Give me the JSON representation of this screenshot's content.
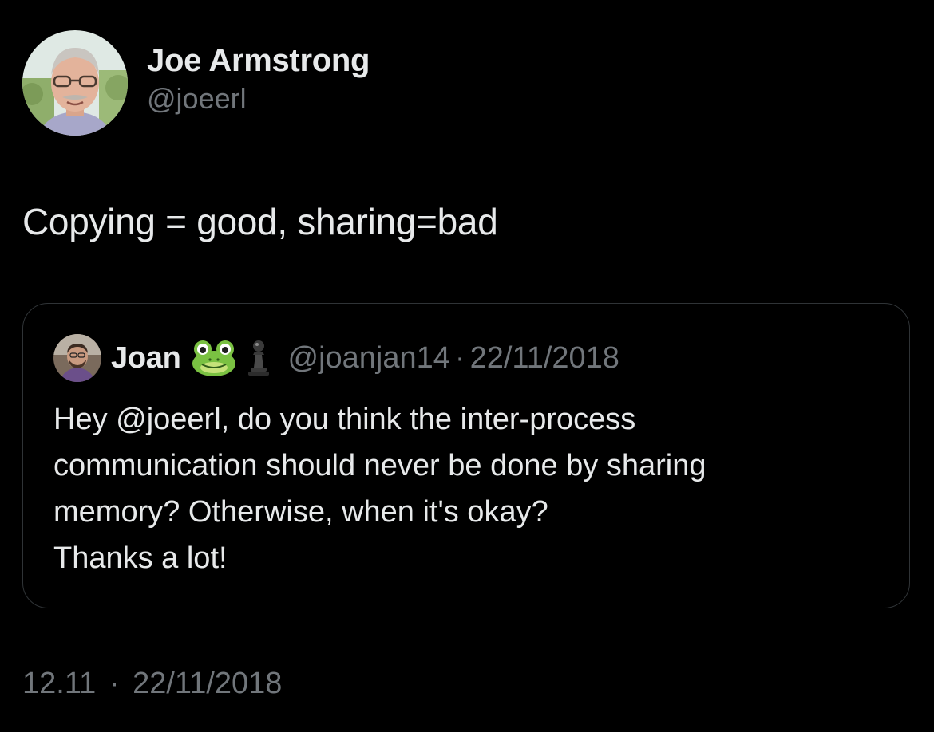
{
  "tweet": {
    "author": {
      "display_name": "Joe Armstrong",
      "handle": "@joeerl"
    },
    "text": "Copying = good, sharing=bad",
    "quoted": {
      "display_name": "Joan",
      "emojis": [
        "frog-emoji",
        "chess-pawn-emoji"
      ],
      "handle": "@joanjan14",
      "separator": "·",
      "date": "22/11/2018",
      "lines": [
        "Hey @joeerl, do you think the inter-process",
        "communication should never be done by sharing",
        "memory? Otherwise, when it's okay?",
        "Thanks a lot!"
      ]
    },
    "footer": {
      "time": "12.11",
      "separator": "·",
      "date": "22/11/2018"
    }
  },
  "colors": {
    "background": "#000000",
    "text_primary": "#e7e9ea",
    "text_secondary": "#71767b",
    "border": "#2f3336"
  }
}
